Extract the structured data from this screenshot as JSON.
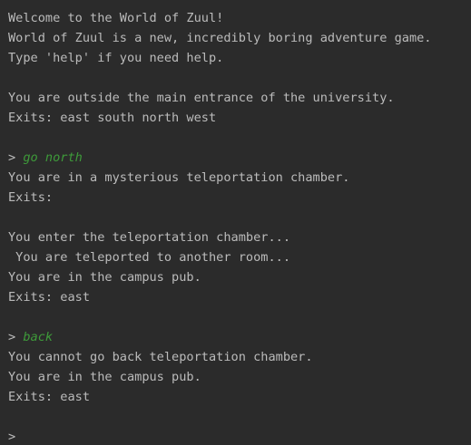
{
  "console": {
    "welcome": [
      "Welcome to the World of Zuul!",
      "World of Zuul is a new, incredibly boring adventure game.",
      "Type 'help' if you need help."
    ],
    "start_location": "You are outside the main entrance of the university.",
    "start_exits": "Exits: east south north west",
    "prompt": ">",
    "command_1": "go north",
    "response_1": [
      "You are in a mysterious teleportation chamber.",
      "Exits:"
    ],
    "response_2": [
      "You enter the teleportation chamber...",
      " You are teleported to another room...",
      "You are in the campus pub.",
      "Exits: east"
    ],
    "command_2": "back",
    "response_3": [
      "You cannot go back teleportation chamber.",
      "You are in the campus pub.",
      "Exits: east"
    ]
  },
  "colors": {
    "background": "#2b2b2b",
    "output_text": "#bbbbbb",
    "user_input": "#3e9b3a"
  }
}
